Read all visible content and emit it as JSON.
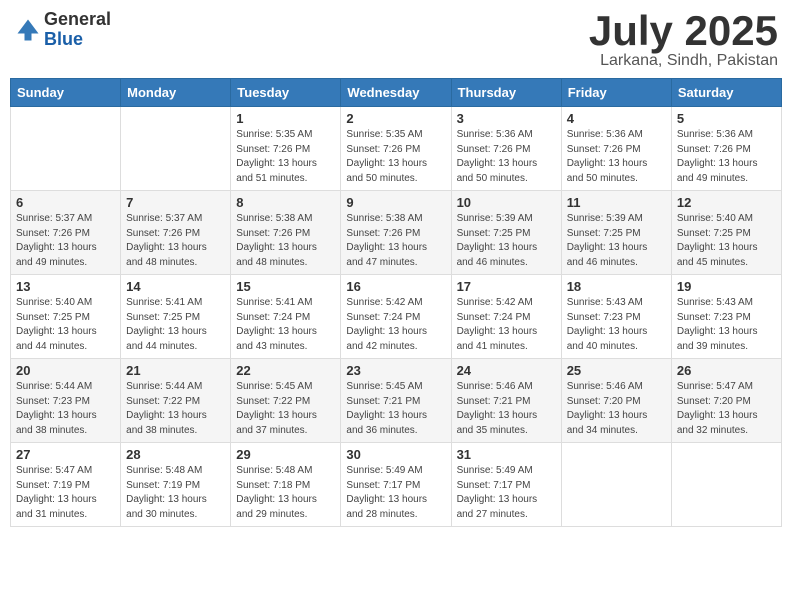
{
  "logo": {
    "general": "General",
    "blue": "Blue"
  },
  "title": "July 2025",
  "location": "Larkana, Sindh, Pakistan",
  "days_of_week": [
    "Sunday",
    "Monday",
    "Tuesday",
    "Wednesday",
    "Thursday",
    "Friday",
    "Saturday"
  ],
  "weeks": [
    [
      {
        "day": "",
        "sunrise": "",
        "sunset": "",
        "daylight": ""
      },
      {
        "day": "",
        "sunrise": "",
        "sunset": "",
        "daylight": ""
      },
      {
        "day": "1",
        "sunrise": "Sunrise: 5:35 AM",
        "sunset": "Sunset: 7:26 PM",
        "daylight": "Daylight: 13 hours and 51 minutes."
      },
      {
        "day": "2",
        "sunrise": "Sunrise: 5:35 AM",
        "sunset": "Sunset: 7:26 PM",
        "daylight": "Daylight: 13 hours and 50 minutes."
      },
      {
        "day": "3",
        "sunrise": "Sunrise: 5:36 AM",
        "sunset": "Sunset: 7:26 PM",
        "daylight": "Daylight: 13 hours and 50 minutes."
      },
      {
        "day": "4",
        "sunrise": "Sunrise: 5:36 AM",
        "sunset": "Sunset: 7:26 PM",
        "daylight": "Daylight: 13 hours and 50 minutes."
      },
      {
        "day": "5",
        "sunrise": "Sunrise: 5:36 AM",
        "sunset": "Sunset: 7:26 PM",
        "daylight": "Daylight: 13 hours and 49 minutes."
      }
    ],
    [
      {
        "day": "6",
        "sunrise": "Sunrise: 5:37 AM",
        "sunset": "Sunset: 7:26 PM",
        "daylight": "Daylight: 13 hours and 49 minutes."
      },
      {
        "day": "7",
        "sunrise": "Sunrise: 5:37 AM",
        "sunset": "Sunset: 7:26 PM",
        "daylight": "Daylight: 13 hours and 48 minutes."
      },
      {
        "day": "8",
        "sunrise": "Sunrise: 5:38 AM",
        "sunset": "Sunset: 7:26 PM",
        "daylight": "Daylight: 13 hours and 48 minutes."
      },
      {
        "day": "9",
        "sunrise": "Sunrise: 5:38 AM",
        "sunset": "Sunset: 7:26 PM",
        "daylight": "Daylight: 13 hours and 47 minutes."
      },
      {
        "day": "10",
        "sunrise": "Sunrise: 5:39 AM",
        "sunset": "Sunset: 7:25 PM",
        "daylight": "Daylight: 13 hours and 46 minutes."
      },
      {
        "day": "11",
        "sunrise": "Sunrise: 5:39 AM",
        "sunset": "Sunset: 7:25 PM",
        "daylight": "Daylight: 13 hours and 46 minutes."
      },
      {
        "day": "12",
        "sunrise": "Sunrise: 5:40 AM",
        "sunset": "Sunset: 7:25 PM",
        "daylight": "Daylight: 13 hours and 45 minutes."
      }
    ],
    [
      {
        "day": "13",
        "sunrise": "Sunrise: 5:40 AM",
        "sunset": "Sunset: 7:25 PM",
        "daylight": "Daylight: 13 hours and 44 minutes."
      },
      {
        "day": "14",
        "sunrise": "Sunrise: 5:41 AM",
        "sunset": "Sunset: 7:25 PM",
        "daylight": "Daylight: 13 hours and 44 minutes."
      },
      {
        "day": "15",
        "sunrise": "Sunrise: 5:41 AM",
        "sunset": "Sunset: 7:24 PM",
        "daylight": "Daylight: 13 hours and 43 minutes."
      },
      {
        "day": "16",
        "sunrise": "Sunrise: 5:42 AM",
        "sunset": "Sunset: 7:24 PM",
        "daylight": "Daylight: 13 hours and 42 minutes."
      },
      {
        "day": "17",
        "sunrise": "Sunrise: 5:42 AM",
        "sunset": "Sunset: 7:24 PM",
        "daylight": "Daylight: 13 hours and 41 minutes."
      },
      {
        "day": "18",
        "sunrise": "Sunrise: 5:43 AM",
        "sunset": "Sunset: 7:23 PM",
        "daylight": "Daylight: 13 hours and 40 minutes."
      },
      {
        "day": "19",
        "sunrise": "Sunrise: 5:43 AM",
        "sunset": "Sunset: 7:23 PM",
        "daylight": "Daylight: 13 hours and 39 minutes."
      }
    ],
    [
      {
        "day": "20",
        "sunrise": "Sunrise: 5:44 AM",
        "sunset": "Sunset: 7:23 PM",
        "daylight": "Daylight: 13 hours and 38 minutes."
      },
      {
        "day": "21",
        "sunrise": "Sunrise: 5:44 AM",
        "sunset": "Sunset: 7:22 PM",
        "daylight": "Daylight: 13 hours and 38 minutes."
      },
      {
        "day": "22",
        "sunrise": "Sunrise: 5:45 AM",
        "sunset": "Sunset: 7:22 PM",
        "daylight": "Daylight: 13 hours and 37 minutes."
      },
      {
        "day": "23",
        "sunrise": "Sunrise: 5:45 AM",
        "sunset": "Sunset: 7:21 PM",
        "daylight": "Daylight: 13 hours and 36 minutes."
      },
      {
        "day": "24",
        "sunrise": "Sunrise: 5:46 AM",
        "sunset": "Sunset: 7:21 PM",
        "daylight": "Daylight: 13 hours and 35 minutes."
      },
      {
        "day": "25",
        "sunrise": "Sunrise: 5:46 AM",
        "sunset": "Sunset: 7:20 PM",
        "daylight": "Daylight: 13 hours and 34 minutes."
      },
      {
        "day": "26",
        "sunrise": "Sunrise: 5:47 AM",
        "sunset": "Sunset: 7:20 PM",
        "daylight": "Daylight: 13 hours and 32 minutes."
      }
    ],
    [
      {
        "day": "27",
        "sunrise": "Sunrise: 5:47 AM",
        "sunset": "Sunset: 7:19 PM",
        "daylight": "Daylight: 13 hours and 31 minutes."
      },
      {
        "day": "28",
        "sunrise": "Sunrise: 5:48 AM",
        "sunset": "Sunset: 7:19 PM",
        "daylight": "Daylight: 13 hours and 30 minutes."
      },
      {
        "day": "29",
        "sunrise": "Sunrise: 5:48 AM",
        "sunset": "Sunset: 7:18 PM",
        "daylight": "Daylight: 13 hours and 29 minutes."
      },
      {
        "day": "30",
        "sunrise": "Sunrise: 5:49 AM",
        "sunset": "Sunset: 7:17 PM",
        "daylight": "Daylight: 13 hours and 28 minutes."
      },
      {
        "day": "31",
        "sunrise": "Sunrise: 5:49 AM",
        "sunset": "Sunset: 7:17 PM",
        "daylight": "Daylight: 13 hours and 27 minutes."
      },
      {
        "day": "",
        "sunrise": "",
        "sunset": "",
        "daylight": ""
      },
      {
        "day": "",
        "sunrise": "",
        "sunset": "",
        "daylight": ""
      }
    ]
  ]
}
